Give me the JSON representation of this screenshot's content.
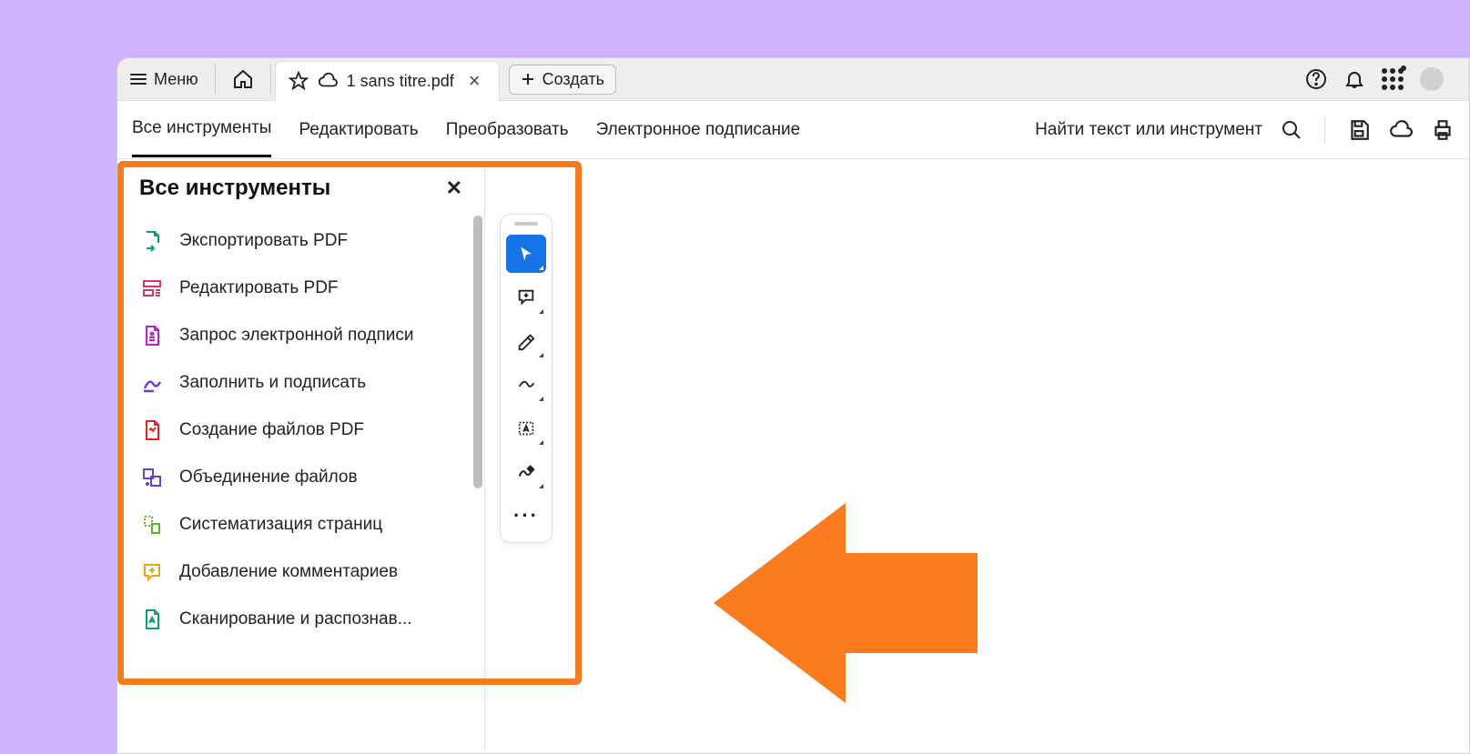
{
  "titlebar": {
    "menu_label": "Меню",
    "tab_title": "1 sans titre.pdf",
    "create_label": "Создать"
  },
  "toolbar": {
    "tabs": [
      "Все инструменты",
      "Редактировать",
      "Преобразовать",
      "Электронное подписание"
    ],
    "search_placeholder": "Найти текст или инструмент"
  },
  "panel": {
    "title": "Все инструменты",
    "items": [
      "Экспортировать PDF",
      "Редактировать PDF",
      "Запрос электронной подписи",
      "Заполнить и подписать",
      "Создание файлов PDF",
      "Объединение файлов",
      "Систематизация страниц",
      "Добавление комментариев",
      "Сканирование и распознав..."
    ]
  },
  "colors": {
    "accent": "#1473e6",
    "highlight": "#fa7a1e"
  }
}
